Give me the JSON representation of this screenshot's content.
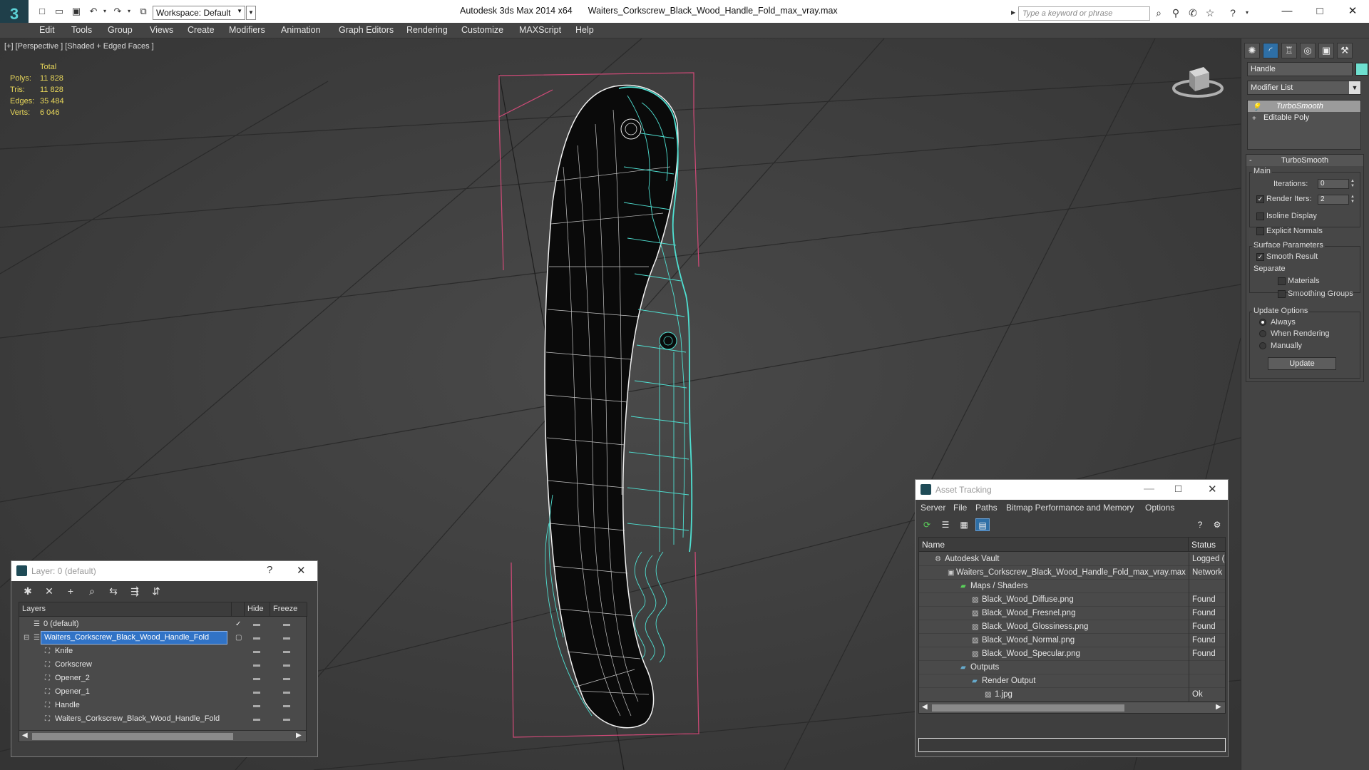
{
  "titlebar": {
    "workspace": "Workspace: Default",
    "app_name": "Autodesk 3ds Max  2014 x64",
    "file_name": "Waiters_Corkscrew_Black_Wood_Handle_Fold_max_vray.max",
    "search_placeholder": "Type a keyword or phrase"
  },
  "menu": [
    "Edit",
    "Tools",
    "Group",
    "Views",
    "Create",
    "Modifiers",
    "Animation",
    "Graph Editors",
    "Rendering",
    "Customize",
    "MAXScript",
    "Help"
  ],
  "viewport": {
    "label": "[+] [Perspective ] [Shaded + Edged Faces ]",
    "stats": {
      "header": "Total",
      "rows": [
        {
          "label": "Polys:",
          "value": "11 828"
        },
        {
          "label": "Tris:",
          "value": "11 828"
        },
        {
          "label": "Edges:",
          "value": "35 484"
        },
        {
          "label": "Verts:",
          "value": "6 046"
        }
      ]
    }
  },
  "command_panel": {
    "object_name": "Handle",
    "object_color": "#6fe0d0",
    "modifier_list": "Modifier List",
    "stack": [
      "TurboSmooth",
      "Editable Poly"
    ],
    "rollout_title": "TurboSmooth",
    "main_group": "Main",
    "iterations_label": "Iterations:",
    "iterations_value": "0",
    "render_iters_label": "Render Iters:",
    "render_iters_value": "2",
    "render_iters_checked": true,
    "isoline_label": "Isoline Display",
    "explicit_normals_label": "Explicit Normals",
    "surface_group": "Surface Parameters",
    "smooth_result_label": "Smooth Result",
    "separate_label": "Separate",
    "materials_label": "Materials",
    "smoothing_groups_label": "Smoothing Groups",
    "update_group": "Update Options",
    "update_options": [
      "Always",
      "When Rendering",
      "Manually"
    ],
    "update_selected": "Always",
    "update_button": "Update"
  },
  "layer_window": {
    "title": "Layer: 0 (default)",
    "help": "?",
    "columns": [
      "Layers",
      "Hide",
      "Freeze"
    ],
    "rows": [
      {
        "name": "0 (default)",
        "level": 0,
        "current": true
      },
      {
        "name": "Waiters_Corkscrew_Black_Wood_Handle_Fold",
        "level": 0,
        "selected": true
      },
      {
        "name": "Knife",
        "level": 1
      },
      {
        "name": "Corkscrew",
        "level": 1
      },
      {
        "name": "Opener_2",
        "level": 1
      },
      {
        "name": "Opener_1",
        "level": 1
      },
      {
        "name": "Handle",
        "level": 1
      },
      {
        "name": "Waiters_Corkscrew_Black_Wood_Handle_Fold",
        "level": 1
      }
    ]
  },
  "asset_window": {
    "title": "Asset Tracking",
    "menu": [
      "Server",
      "File",
      "Paths",
      "Bitmap Performance and Memory",
      "Options"
    ],
    "columns": [
      "Name",
      "Status"
    ],
    "rows": [
      {
        "name": "Autodesk Vault",
        "status": "Logged (",
        "level": 0
      },
      {
        "name": "Waiters_Corkscrew_Black_Wood_Handle_Fold_max_vray.max",
        "status": "Network",
        "level": 1
      },
      {
        "name": "Maps / Shaders",
        "status": "",
        "level": 2
      },
      {
        "name": "Black_Wood_Diffuse.png",
        "status": "Found",
        "level": 3
      },
      {
        "name": "Black_Wood_Fresnel.png",
        "status": "Found",
        "level": 3
      },
      {
        "name": "Black_Wood_Glossiness.png",
        "status": "Found",
        "level": 3
      },
      {
        "name": "Black_Wood_Normal.png",
        "status": "Found",
        "level": 3
      },
      {
        "name": "Black_Wood_Specular.png",
        "status": "Found",
        "level": 3
      },
      {
        "name": "Outputs",
        "status": "",
        "level": 2
      },
      {
        "name": "Render Output",
        "status": "",
        "level": 3
      },
      {
        "name": "1.jpg",
        "status": "Ok",
        "level": 4
      }
    ]
  },
  "colors": {
    "selection_blue": "#3173c6",
    "wire_cyan": "#4fe0d2",
    "bbox_pink": "#d04a78",
    "stats_yellow": "#e8d75a"
  }
}
